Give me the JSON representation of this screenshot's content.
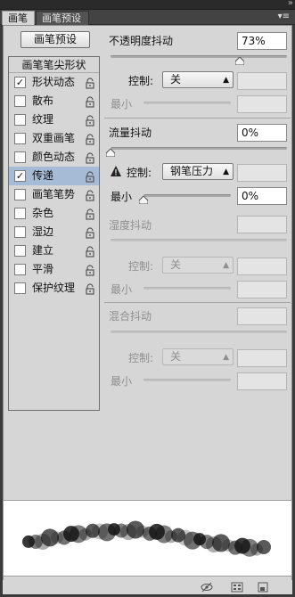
{
  "tabs": [
    {
      "label": "画笔",
      "active": true
    },
    {
      "label": "画笔预设",
      "active": false
    }
  ],
  "preset_button": "画笔预设",
  "brush_list": {
    "header": "画笔笔尖形状",
    "items": [
      {
        "label": "形状动态",
        "checked": true,
        "selected": false
      },
      {
        "label": "散布",
        "checked": false,
        "selected": false
      },
      {
        "label": "纹理",
        "checked": false,
        "selected": false
      },
      {
        "label": "双重画笔",
        "checked": false,
        "selected": false
      },
      {
        "label": "颜色动态",
        "checked": false,
        "selected": false
      },
      {
        "label": "传递",
        "checked": true,
        "selected": true
      },
      {
        "label": "画笔笔势",
        "checked": false,
        "selected": false
      },
      {
        "label": "杂色",
        "checked": false,
        "selected": false
      },
      {
        "label": "湿边",
        "checked": false,
        "selected": false
      },
      {
        "label": "建立",
        "checked": false,
        "selected": false
      },
      {
        "label": "平滑",
        "checked": false,
        "selected": false
      },
      {
        "label": "保护纹理",
        "checked": false,
        "selected": false
      }
    ]
  },
  "opacity_jitter": {
    "label": "不透明度抖动",
    "value": "73%",
    "slider_fraction": 0.73,
    "control_label": "控制:",
    "control_value": "关",
    "min_label": "最小"
  },
  "flow_jitter": {
    "label": "流量抖动",
    "value": "0%",
    "slider_fraction": 0,
    "control_label": "控制:",
    "control_value": "钢笔压力",
    "min_label": "最小",
    "min_value": "0%",
    "min_fraction": 0
  },
  "wetness_jitter": {
    "label": "湿度抖动",
    "control_label": "控制:",
    "control_value": "关",
    "min_label": "最小"
  },
  "mix_jitter": {
    "label": "混合抖动",
    "control_label": "控制:",
    "control_value": "关",
    "min_label": "最小"
  }
}
